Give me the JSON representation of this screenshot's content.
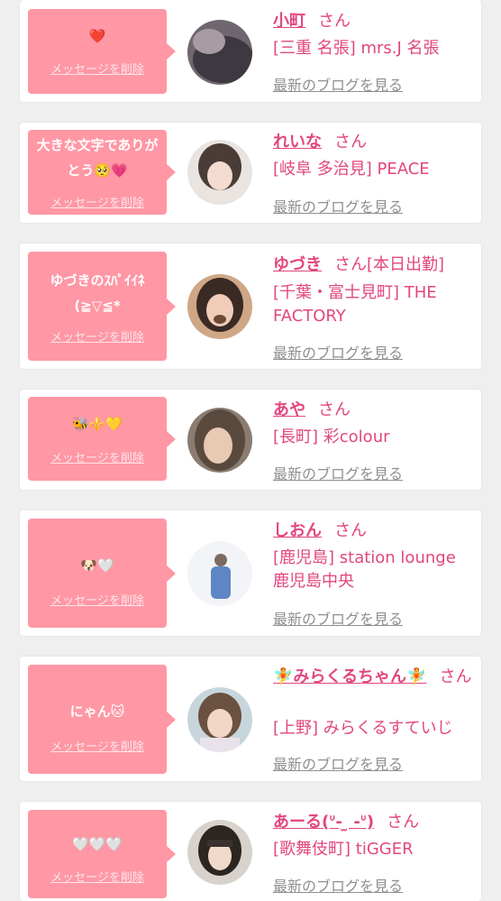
{
  "delete_label": "メッセージを削除",
  "blog_label": "最新のブログを見る",
  "honorific": "さん",
  "cards": [
    {
      "message": "❤️",
      "name": "小町",
      "status": "",
      "shop": "[三重 名張] mrs.J 名張"
    },
    {
      "message": "大きな文字でありがとう🥺💗",
      "name": "れいな",
      "status": "",
      "shop": "[岐阜 多治見] PEACE"
    },
    {
      "message": "ゆづきのｽﾊﾟｲｲﾈ(≧▽≦*",
      "name": "ゆづき",
      "status": "[本日出勤]",
      "shop": "[千葉・富士見町] THE FACTORY"
    },
    {
      "message": "🐝⚜️💛",
      "name": "あや",
      "status": "",
      "shop": "[長町] 彩colour"
    },
    {
      "message": "🐶🤍",
      "name": "しおん",
      "status": "",
      "shop": "[鹿児島] station lounge 鹿児島中央"
    },
    {
      "message": "にゃん🐱",
      "name": "🧚みらくるちゃん🧚",
      "status": "",
      "shop": "[上野] みらくるすていじ"
    },
    {
      "message": "🤍🤍🤍",
      "name": "あーる(ᐡ- ̫ -ᐡ)",
      "status": "",
      "shop": "[歌舞伎町] tiGGER"
    }
  ],
  "colors": {
    "bubble": "#ff97a4",
    "name": "#e2467f",
    "link": "#8f8f8f",
    "background": "#efefef"
  }
}
